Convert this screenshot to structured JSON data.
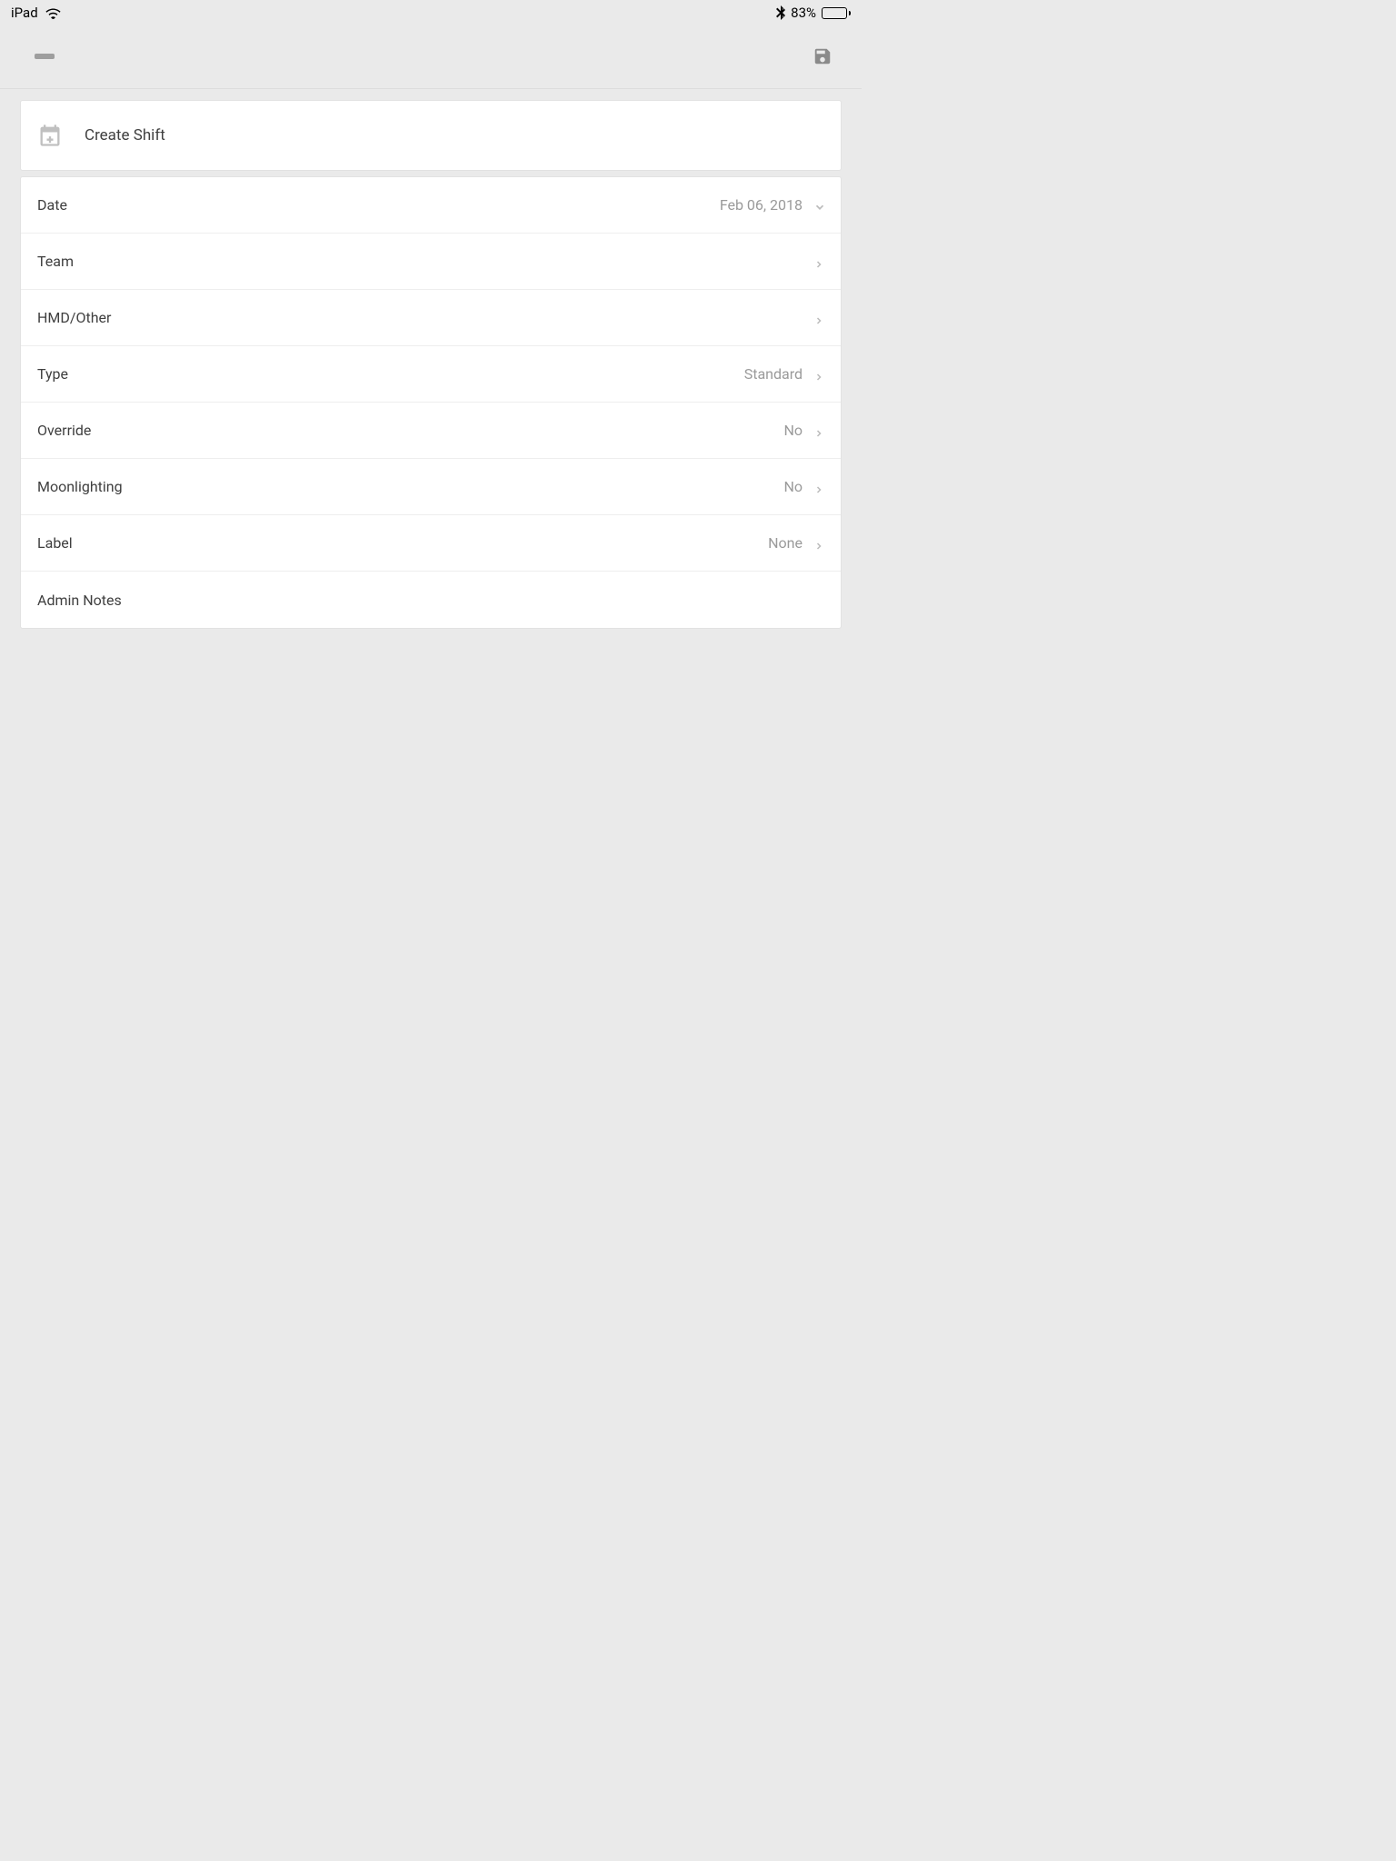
{
  "statusBar": {
    "device": "iPad",
    "batteryPercent": "83%"
  },
  "header": {
    "title": "Create Shift"
  },
  "form": {
    "date": {
      "label": "Date",
      "value": "Feb 06, 2018"
    },
    "team": {
      "label": "Team",
      "value": ""
    },
    "hmd": {
      "label": "HMD/Other",
      "value": ""
    },
    "type": {
      "label": "Type",
      "value": "Standard"
    },
    "override": {
      "label": "Override",
      "value": "No"
    },
    "moonlighting": {
      "label": "Moonlighting",
      "value": "No"
    },
    "shiftLabel": {
      "label": "Label",
      "value": "None"
    },
    "adminNotes": {
      "label": "Admin Notes",
      "value": ""
    }
  }
}
